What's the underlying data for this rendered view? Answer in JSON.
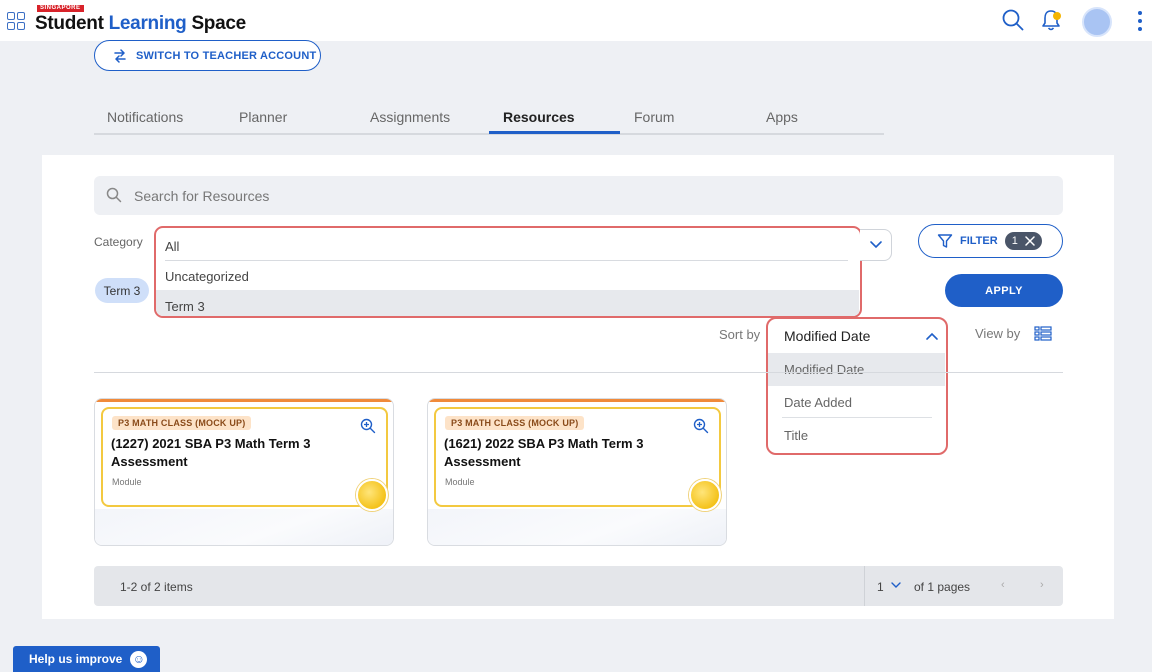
{
  "header": {
    "logo_country": "SINGAPORE",
    "logo_word1": "Student",
    "logo_word2": "Learning",
    "logo_word3": "Space",
    "icons": [
      "apps-grid-icon",
      "search-icon",
      "bell-icon",
      "avatar",
      "kebab-menu-icon"
    ]
  },
  "switch_account": {
    "label": "SWITCH TO TEACHER ACCOUNT",
    "icon": "swap-icon"
  },
  "tabs": [
    {
      "label": "Notifications"
    },
    {
      "label": "Planner"
    },
    {
      "label": "Assignments"
    },
    {
      "label": "Resources"
    },
    {
      "label": "Forum"
    },
    {
      "label": "Apps"
    }
  ],
  "active_tab": "Resources",
  "search": {
    "placeholder": "Search for Resources"
  },
  "category": {
    "label": "Category",
    "options": [
      "All",
      "Uncategorized",
      "Term 3"
    ],
    "highlighted": "Term 3"
  },
  "filter": {
    "label": "FILTER",
    "count": "1"
  },
  "apply": {
    "label": "APPLY"
  },
  "active_chip": {
    "label": "Term 3"
  },
  "sort": {
    "label": "Sort by",
    "selected": "Modified Date",
    "options": [
      "Modified Date",
      "Date Added",
      "Title"
    ]
  },
  "view_by": {
    "label": "View by"
  },
  "cards": [
    {
      "tag": "P3 MATH CLASS (MOCK UP)",
      "title": "(1227) 2021 SBA P3 Math Term 3 Assessment",
      "type": "Module"
    },
    {
      "tag": "P3 MATH CLASS (MOCK UP)",
      "title": "(1621) 2022 SBA P3 Math Term 3 Assessment",
      "type": "Module"
    }
  ],
  "pagination": {
    "summary": "1-2 of 2 items",
    "page": "1",
    "of_pages": "of 1 pages",
    "prev": "‹",
    "next": "›"
  },
  "help": {
    "label": "Help us improve",
    "icon": "☺"
  },
  "colors": {
    "brand_blue": "#1f5fc8",
    "highlight_red": "#e06a6a",
    "card_stripe": "#f08a3a",
    "card_border": "#f3c940"
  }
}
